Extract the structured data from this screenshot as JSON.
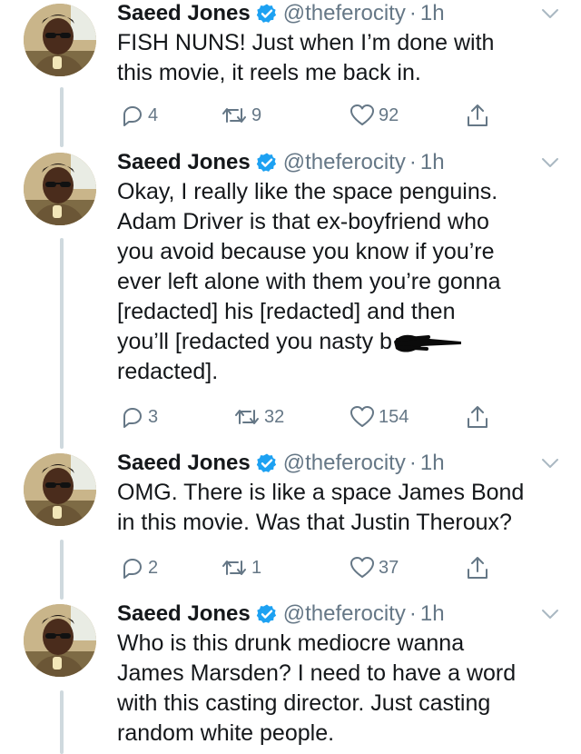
{
  "colors": {
    "text": "#14171a",
    "secondary": "#657786",
    "verified_blue": "#1da1f2",
    "thread_line": "#cfd9de"
  },
  "tweets": [
    {
      "name": "Saeed Jones",
      "handle": "@theferocity",
      "separator": "·",
      "time": "1h",
      "lines": [
        "FISH NUNS! Just when I’m done with",
        "this movie, it reels me back in."
      ],
      "replies": "4",
      "retweets": "9",
      "likes": "92"
    },
    {
      "name": "Saeed Jones",
      "handle": "@theferocity",
      "separator": "·",
      "time": "1h",
      "lines": [
        "Okay, I really like the space penguins.",
        "Adam Driver is that ex-boyfriend who",
        "you avoid because you know if you’re",
        "ever left alone with them you’re gonna",
        "[redacted] his [redacted] and then",
        "you’ll [redacted you nasty b",
        "redacted]."
      ],
      "replies": "3",
      "retweets": "32",
      "likes": "154"
    },
    {
      "name": "Saeed Jones",
      "handle": "@theferocity",
      "separator": "·",
      "time": "1h",
      "lines": [
        "OMG. There is like a space James Bond",
        "in this movie. Was that Justin Theroux?"
      ],
      "replies": "2",
      "retweets": "1",
      "likes": "37"
    },
    {
      "name": "Saeed Jones",
      "handle": "@theferocity",
      "separator": "·",
      "time": "1h",
      "lines": [
        "Who is this drunk mediocre wanna",
        "James Marsden? I need to have a word",
        "with this casting director. Just casting",
        "random white people."
      ]
    }
  ]
}
